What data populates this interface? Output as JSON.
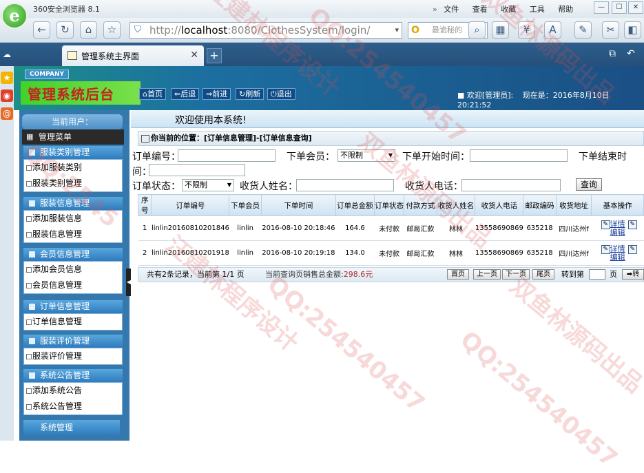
{
  "browser": {
    "app_title": "360安全浏览器 8.1",
    "menus": [
      "文件",
      "查看",
      "收藏",
      "工具",
      "帮助"
    ],
    "address_prefix": "http://",
    "address_host": "localhost",
    "address_rest": ":8080/ClothesSystem/login/",
    "search_placeholder": "最诡秘的",
    "tab_title": "管理系统主界面"
  },
  "header": {
    "company": "COMPANY",
    "brand": "管理系统后台",
    "buttons": [
      "首页",
      "后退",
      "前进",
      "刷新",
      "退出"
    ],
    "welcome": "欢迎[管理员]:",
    "time_label": "现在是：",
    "time_value": "2016年8月10日 20:21:52"
  },
  "sidebar": {
    "current_user": "当前用户：",
    "menu_title": "管理菜单",
    "groups": [
      {
        "title": "服装类别管理",
        "items": [
          "添加服装类别",
          "服装类别管理"
        ]
      },
      {
        "title": "服装信息管理",
        "items": [
          "添加服装信息",
          "服装信息管理"
        ]
      },
      {
        "title": "会员信息管理",
        "items": [
          "添加会员信息",
          "会员信息管理"
        ]
      },
      {
        "title": "订单信息管理",
        "items": [
          "订单信息管理"
        ]
      },
      {
        "title": "服装评价管理",
        "items": [
          "服装评价管理"
        ]
      },
      {
        "title": "系统公告管理",
        "items": [
          "添加系统公告",
          "系统公告管理"
        ]
      }
    ],
    "system": "系统管理"
  },
  "main": {
    "welcome": "欢迎使用本系统!",
    "breadcrumb": "你当前的位置：[订单信息管理]-[订单信息查询]",
    "form": {
      "order_no": "订单编号：",
      "member": "下单会员：",
      "member_value": "不限制",
      "start_time": "下单开始时间：",
      "end_time": "下单结束时",
      "end_time2": "间：",
      "status": "订单状态：",
      "status_value": "不限制",
      "receiver": "收货人姓名：",
      "phone": "收货人电话：",
      "query": "查询"
    },
    "columns": [
      "序号",
      "订单编号",
      "下单会员",
      "下单时间",
      "订单总金额",
      "订单状态",
      "付款方式",
      "收货人姓名",
      "收货人电话",
      "邮政编码",
      "收货地址",
      "基本操作"
    ],
    "rows": [
      {
        "no": "1",
        "order": "linlin20160810201846",
        "member": "linlin",
        "time": "2016-08-10 20:18:46",
        "amount": "164.6",
        "status": "未付款",
        "pay": "邮局汇款",
        "name": "林林",
        "phone": "13558690869",
        "zip": "635218",
        "addr": "四川达州f",
        "op1": "详情",
        "op2": "编辑"
      },
      {
        "no": "2",
        "order": "linlin20160810201918",
        "member": "linlin",
        "time": "2016-08-10 20:19:18",
        "amount": "134.0",
        "status": "未付款",
        "pay": "邮局汇款",
        "name": "林林",
        "phone": "13558690869",
        "zip": "635218",
        "addr": "四川达州f",
        "op1": "详情",
        "op2": "编辑"
      }
    ],
    "pager": {
      "summary": "共有2条记录，当前第 1/1 页",
      "total_label": "当前查询页销售总金额:",
      "total_value": "298.6元",
      "first": "首页",
      "prev": "上一页",
      "next": "下一页",
      "last": "尾页",
      "goto": "转到第",
      "page": "页",
      "go": "转"
    }
  },
  "watermarks": [
    "汪建林程序设计",
    "双鱼林源码出品",
    "QQ:254540457",
    "QQ:2545",
    "双鱼林源码出品",
    "汪建林程序设计",
    "QQ:254540457",
    "双鱼林源码出品",
    "QQ:254540457"
  ]
}
